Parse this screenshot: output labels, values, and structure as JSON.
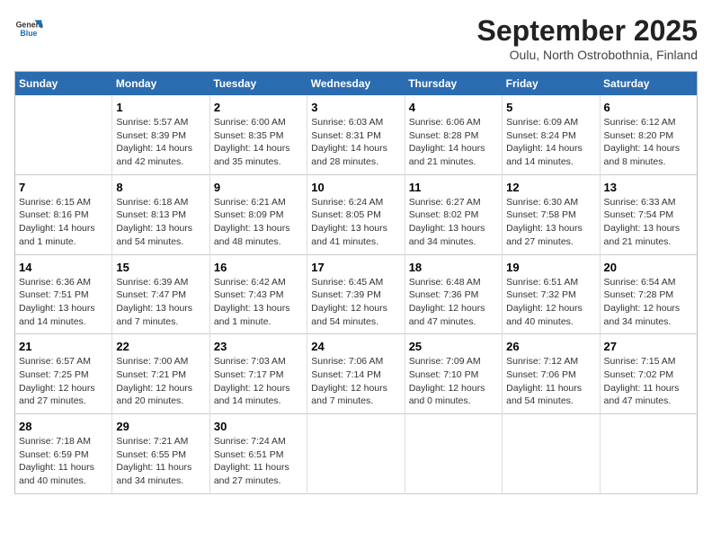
{
  "header": {
    "logo_line1": "General",
    "logo_line2": "Blue",
    "month_title": "September 2025",
    "location": "Oulu, North Ostrobothnia, Finland"
  },
  "days_header": [
    "Sunday",
    "Monday",
    "Tuesday",
    "Wednesday",
    "Thursday",
    "Friday",
    "Saturday"
  ],
  "weeks": [
    [
      {
        "day": "",
        "sunrise": "",
        "sunset": "",
        "daylight": ""
      },
      {
        "day": "1",
        "sunrise": "Sunrise: 5:57 AM",
        "sunset": "Sunset: 8:39 PM",
        "daylight": "Daylight: 14 hours and 42 minutes."
      },
      {
        "day": "2",
        "sunrise": "Sunrise: 6:00 AM",
        "sunset": "Sunset: 8:35 PM",
        "daylight": "Daylight: 14 hours and 35 minutes."
      },
      {
        "day": "3",
        "sunrise": "Sunrise: 6:03 AM",
        "sunset": "Sunset: 8:31 PM",
        "daylight": "Daylight: 14 hours and 28 minutes."
      },
      {
        "day": "4",
        "sunrise": "Sunrise: 6:06 AM",
        "sunset": "Sunset: 8:28 PM",
        "daylight": "Daylight: 14 hours and 21 minutes."
      },
      {
        "day": "5",
        "sunrise": "Sunrise: 6:09 AM",
        "sunset": "Sunset: 8:24 PM",
        "daylight": "Daylight: 14 hours and 14 minutes."
      },
      {
        "day": "6",
        "sunrise": "Sunrise: 6:12 AM",
        "sunset": "Sunset: 8:20 PM",
        "daylight": "Daylight: 14 hours and 8 minutes."
      }
    ],
    [
      {
        "day": "7",
        "sunrise": "Sunrise: 6:15 AM",
        "sunset": "Sunset: 8:16 PM",
        "daylight": "Daylight: 14 hours and 1 minute."
      },
      {
        "day": "8",
        "sunrise": "Sunrise: 6:18 AM",
        "sunset": "Sunset: 8:13 PM",
        "daylight": "Daylight: 13 hours and 54 minutes."
      },
      {
        "day": "9",
        "sunrise": "Sunrise: 6:21 AM",
        "sunset": "Sunset: 8:09 PM",
        "daylight": "Daylight: 13 hours and 48 minutes."
      },
      {
        "day": "10",
        "sunrise": "Sunrise: 6:24 AM",
        "sunset": "Sunset: 8:05 PM",
        "daylight": "Daylight: 13 hours and 41 minutes."
      },
      {
        "day": "11",
        "sunrise": "Sunrise: 6:27 AM",
        "sunset": "Sunset: 8:02 PM",
        "daylight": "Daylight: 13 hours and 34 minutes."
      },
      {
        "day": "12",
        "sunrise": "Sunrise: 6:30 AM",
        "sunset": "Sunset: 7:58 PM",
        "daylight": "Daylight: 13 hours and 27 minutes."
      },
      {
        "day": "13",
        "sunrise": "Sunrise: 6:33 AM",
        "sunset": "Sunset: 7:54 PM",
        "daylight": "Daylight: 13 hours and 21 minutes."
      }
    ],
    [
      {
        "day": "14",
        "sunrise": "Sunrise: 6:36 AM",
        "sunset": "Sunset: 7:51 PM",
        "daylight": "Daylight: 13 hours and 14 minutes."
      },
      {
        "day": "15",
        "sunrise": "Sunrise: 6:39 AM",
        "sunset": "Sunset: 7:47 PM",
        "daylight": "Daylight: 13 hours and 7 minutes."
      },
      {
        "day": "16",
        "sunrise": "Sunrise: 6:42 AM",
        "sunset": "Sunset: 7:43 PM",
        "daylight": "Daylight: 13 hours and 1 minute."
      },
      {
        "day": "17",
        "sunrise": "Sunrise: 6:45 AM",
        "sunset": "Sunset: 7:39 PM",
        "daylight": "Daylight: 12 hours and 54 minutes."
      },
      {
        "day": "18",
        "sunrise": "Sunrise: 6:48 AM",
        "sunset": "Sunset: 7:36 PM",
        "daylight": "Daylight: 12 hours and 47 minutes."
      },
      {
        "day": "19",
        "sunrise": "Sunrise: 6:51 AM",
        "sunset": "Sunset: 7:32 PM",
        "daylight": "Daylight: 12 hours and 40 minutes."
      },
      {
        "day": "20",
        "sunrise": "Sunrise: 6:54 AM",
        "sunset": "Sunset: 7:28 PM",
        "daylight": "Daylight: 12 hours and 34 minutes."
      }
    ],
    [
      {
        "day": "21",
        "sunrise": "Sunrise: 6:57 AM",
        "sunset": "Sunset: 7:25 PM",
        "daylight": "Daylight: 12 hours and 27 minutes."
      },
      {
        "day": "22",
        "sunrise": "Sunrise: 7:00 AM",
        "sunset": "Sunset: 7:21 PM",
        "daylight": "Daylight: 12 hours and 20 minutes."
      },
      {
        "day": "23",
        "sunrise": "Sunrise: 7:03 AM",
        "sunset": "Sunset: 7:17 PM",
        "daylight": "Daylight: 12 hours and 14 minutes."
      },
      {
        "day": "24",
        "sunrise": "Sunrise: 7:06 AM",
        "sunset": "Sunset: 7:14 PM",
        "daylight": "Daylight: 12 hours and 7 minutes."
      },
      {
        "day": "25",
        "sunrise": "Sunrise: 7:09 AM",
        "sunset": "Sunset: 7:10 PM",
        "daylight": "Daylight: 12 hours and 0 minutes."
      },
      {
        "day": "26",
        "sunrise": "Sunrise: 7:12 AM",
        "sunset": "Sunset: 7:06 PM",
        "daylight": "Daylight: 11 hours and 54 minutes."
      },
      {
        "day": "27",
        "sunrise": "Sunrise: 7:15 AM",
        "sunset": "Sunset: 7:02 PM",
        "daylight": "Daylight: 11 hours and 47 minutes."
      }
    ],
    [
      {
        "day": "28",
        "sunrise": "Sunrise: 7:18 AM",
        "sunset": "Sunset: 6:59 PM",
        "daylight": "Daylight: 11 hours and 40 minutes."
      },
      {
        "day": "29",
        "sunrise": "Sunrise: 7:21 AM",
        "sunset": "Sunset: 6:55 PM",
        "daylight": "Daylight: 11 hours and 34 minutes."
      },
      {
        "day": "30",
        "sunrise": "Sunrise: 7:24 AM",
        "sunset": "Sunset: 6:51 PM",
        "daylight": "Daylight: 11 hours and 27 minutes."
      },
      {
        "day": "",
        "sunrise": "",
        "sunset": "",
        "daylight": ""
      },
      {
        "day": "",
        "sunrise": "",
        "sunset": "",
        "daylight": ""
      },
      {
        "day": "",
        "sunrise": "",
        "sunset": "",
        "daylight": ""
      },
      {
        "day": "",
        "sunrise": "",
        "sunset": "",
        "daylight": ""
      }
    ]
  ]
}
